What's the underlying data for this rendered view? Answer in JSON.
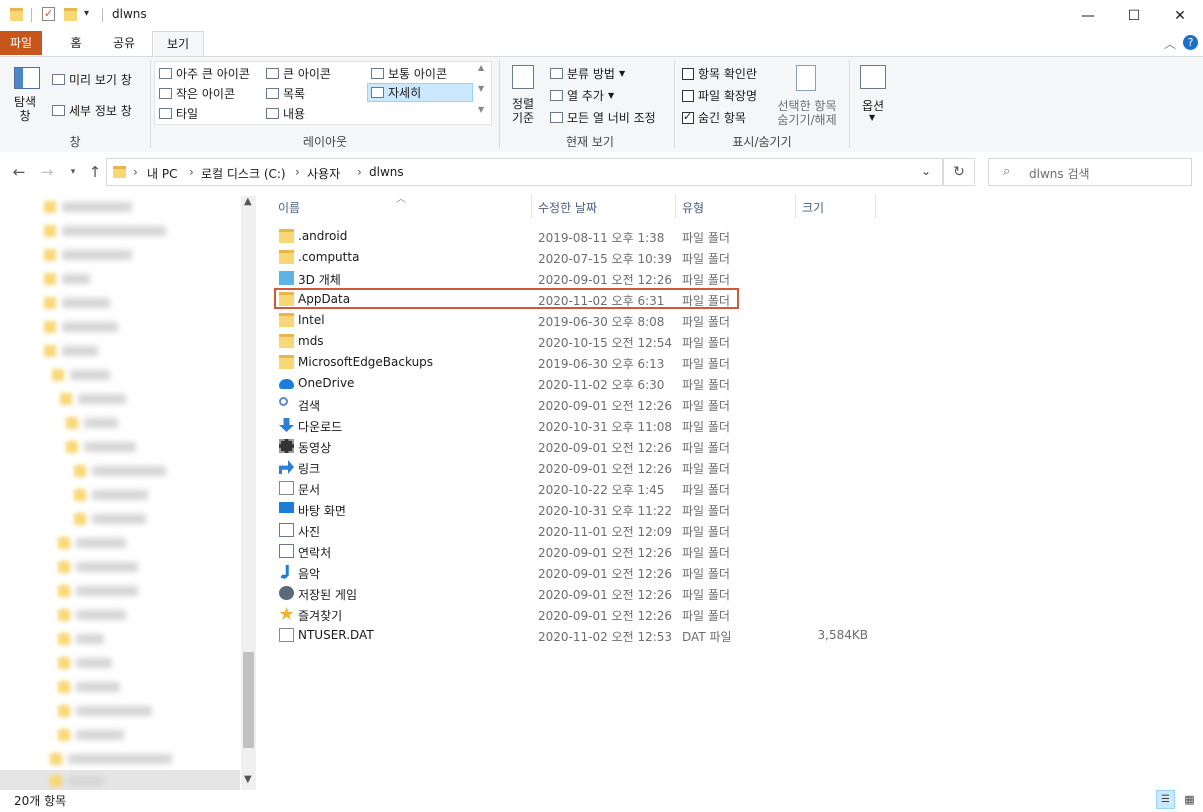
{
  "window": {
    "title": "dlwns",
    "minimize": "—",
    "maximize": "☐",
    "close": "✕"
  },
  "ribbon_tabs": [
    "파일",
    "홈",
    "공유",
    "보기"
  ],
  "ribbon": {
    "pane": {
      "nav_pane_label": "탐색 창",
      "preview_label": "미리 보기 창",
      "details_label": "세부 정보 창",
      "group_label": "창"
    },
    "layout": {
      "items": [
        "아주 큰 아이콘",
        "큰 아이콘",
        "보통 아이콘",
        "작은 아이콘",
        "목록",
        "자세히",
        "타일",
        "내용"
      ],
      "group_label": "레이아웃"
    },
    "current_view": {
      "sort_label": "정렬 기준",
      "group_by": "분류 방법",
      "add_column": "열 추가",
      "fit_columns": "모든 열 너비 조정",
      "group_label": "현재 보기"
    },
    "show_hide": {
      "item_checkbox": "항목 확인란",
      "file_ext": "파일 확장명",
      "hidden_items": "숨긴 항목",
      "hide_selected": "선택한 항목 숨기기/해제",
      "group_label": "표시/숨기기"
    },
    "options_label": "옵션"
  },
  "address": {
    "crumbs": [
      "내 PC",
      "로컬 디스크 (C:)",
      "사용자",
      "dlwns"
    ],
    "search_placeholder": "dlwns 검색"
  },
  "columns": {
    "name": "이름",
    "date": "수정한 날짜",
    "type": "유형",
    "size": "크기"
  },
  "files": [
    {
      "name": ".android",
      "date": "2019-08-11 오후 1:38",
      "type": "파일 폴더",
      "size": "",
      "icon": "folder-icon"
    },
    {
      "name": ".computta",
      "date": "2020-07-15 오후 10:39",
      "type": "파일 폴더",
      "size": "",
      "icon": "folder-icon"
    },
    {
      "name": "3D 개체",
      "date": "2020-09-01 오전 12:26",
      "type": "파일 폴더",
      "size": "",
      "icon": "3d-objects-icon"
    },
    {
      "name": "AppData",
      "date": "2020-11-02 오후 6:31",
      "type": "파일 폴더",
      "size": "",
      "icon": "folder-icon"
    },
    {
      "name": "Intel",
      "date": "2019-06-30 오후 8:08",
      "type": "파일 폴더",
      "size": "",
      "icon": "folder-icon"
    },
    {
      "name": "mds",
      "date": "2020-10-15 오전 12:54",
      "type": "파일 폴더",
      "size": "",
      "icon": "folder-icon"
    },
    {
      "name": "MicrosoftEdgeBackups",
      "date": "2019-06-30 오후 6:13",
      "type": "파일 폴더",
      "size": "",
      "icon": "folder-icon"
    },
    {
      "name": "OneDrive",
      "date": "2020-11-02 오후 6:30",
      "type": "파일 폴더",
      "size": "",
      "icon": "onedrive-icon"
    },
    {
      "name": "검색",
      "date": "2020-09-01 오전 12:26",
      "type": "파일 폴더",
      "size": "",
      "icon": "search-icon"
    },
    {
      "name": "다운로드",
      "date": "2020-10-31 오후 11:08",
      "type": "파일 폴더",
      "size": "",
      "icon": "download-icon"
    },
    {
      "name": "동영상",
      "date": "2020-09-01 오전 12:26",
      "type": "파일 폴더",
      "size": "",
      "icon": "video-icon"
    },
    {
      "name": "링크",
      "date": "2020-09-01 오전 12:26",
      "type": "파일 폴더",
      "size": "",
      "icon": "link-icon"
    },
    {
      "name": "문서",
      "date": "2020-10-22 오후 1:45",
      "type": "파일 폴더",
      "size": "",
      "icon": "document-icon"
    },
    {
      "name": "바탕 화면",
      "date": "2020-10-31 오후 11:22",
      "type": "파일 폴더",
      "size": "",
      "icon": "desktop-icon"
    },
    {
      "name": "사진",
      "date": "2020-11-01 오전 12:09",
      "type": "파일 폴더",
      "size": "",
      "icon": "picture-icon"
    },
    {
      "name": "연락처",
      "date": "2020-09-01 오전 12:26",
      "type": "파일 폴더",
      "size": "",
      "icon": "contacts-icon"
    },
    {
      "name": "음악",
      "date": "2020-09-01 오전 12:26",
      "type": "파일 폴더",
      "size": "",
      "icon": "music-icon"
    },
    {
      "name": "저장된 게임",
      "date": "2020-09-01 오전 12:26",
      "type": "파일 폴더",
      "size": "",
      "icon": "saved-games-icon"
    },
    {
      "name": "즐겨찾기",
      "date": "2020-09-01 오전 12:26",
      "type": "파일 폴더",
      "size": "",
      "icon": "star-icon"
    },
    {
      "name": "NTUSER.DAT",
      "date": "2020-11-02 오전 12:53",
      "type": "DAT 파일",
      "size": "3,584KB",
      "icon": "file-icon"
    }
  ],
  "status": {
    "count": "20개 항목"
  },
  "colors": {
    "accent": "#c6561c",
    "highlight": "#d0583b",
    "folder": "#f8d775"
  }
}
